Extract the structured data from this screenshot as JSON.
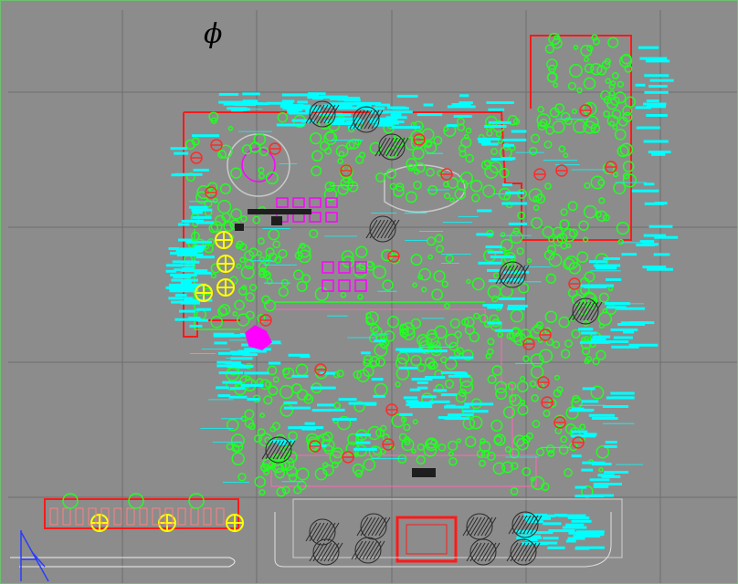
{
  "drawing": {
    "north_symbol": "ϕ",
    "colors": {
      "background": "#8c8c8c",
      "grid": "#6e6e6e",
      "boundary": "#ff1a1a",
      "vegetation": "#22ff22",
      "annotation": "#00ffff",
      "paving": "#ff69b4",
      "structure": "#ff00ff",
      "tree_red": "#ff2a2a",
      "tree_yellow": "#ffff00",
      "hatch": "#2a2a2a",
      "ucs": "#2a3cff"
    },
    "icons": [
      "north-arrow-symbol",
      "ucs-axis-icon"
    ]
  }
}
